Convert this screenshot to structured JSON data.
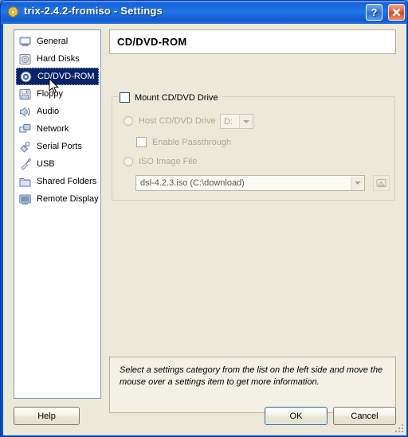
{
  "window": {
    "title": "trix-2.4.2-fromiso  -  Settings",
    "icon": "gear-icon",
    "help_button_label": "?",
    "close_button_label": "x"
  },
  "sidebar": {
    "items": [
      {
        "label": "General",
        "icon": "monitor-icon",
        "selected": false
      },
      {
        "label": "Hard Disks",
        "icon": "hard-disk-icon",
        "selected": false
      },
      {
        "label": "CD/DVD-ROM",
        "icon": "cd-rom-icon",
        "selected": true
      },
      {
        "label": "Floppy",
        "icon": "floppy-disk-icon",
        "selected": false
      },
      {
        "label": "Audio",
        "icon": "speaker-icon",
        "selected": false
      },
      {
        "label": "Network",
        "icon": "network-icon",
        "selected": false
      },
      {
        "label": "Serial Ports",
        "icon": "serial-port-icon",
        "selected": false
      },
      {
        "label": "USB",
        "icon": "usb-plug-icon",
        "selected": false
      },
      {
        "label": "Shared Folders",
        "icon": "folder-icon",
        "selected": false
      },
      {
        "label": "Remote Display",
        "icon": "remote-display-icon",
        "selected": false
      }
    ]
  },
  "panel": {
    "title": "CD/DVD-ROM",
    "mount_checkbox": {
      "label": "Mount CD/DVD Drive",
      "checked": false,
      "enabled": true
    },
    "host_drive": {
      "radio_label": "Host CD/DVD Drive",
      "selected": false,
      "enabled": false,
      "select_value": "D:"
    },
    "passthrough": {
      "label": "Enable Passthrough",
      "checked": false,
      "enabled": false
    },
    "iso_image": {
      "radio_label": "ISO Image File",
      "selected": false,
      "enabled": false,
      "select_value": "dsl-4.2.3.iso (C:\\download)",
      "browse_icon": "folder-browse-icon"
    }
  },
  "info": {
    "text": "Select a settings category from the list on the left side and move the mouse over a settings item to get more information."
  },
  "footer": {
    "help_label": "Help",
    "ok_label": "OK",
    "cancel_label": "Cancel"
  },
  "colors": {
    "titlebar_blue": "#1f76e6",
    "window_border": "#0a52c8",
    "client_bg": "#ece9d8",
    "selection_blue": "#0a246a",
    "disabled_text": "#aca899"
  }
}
